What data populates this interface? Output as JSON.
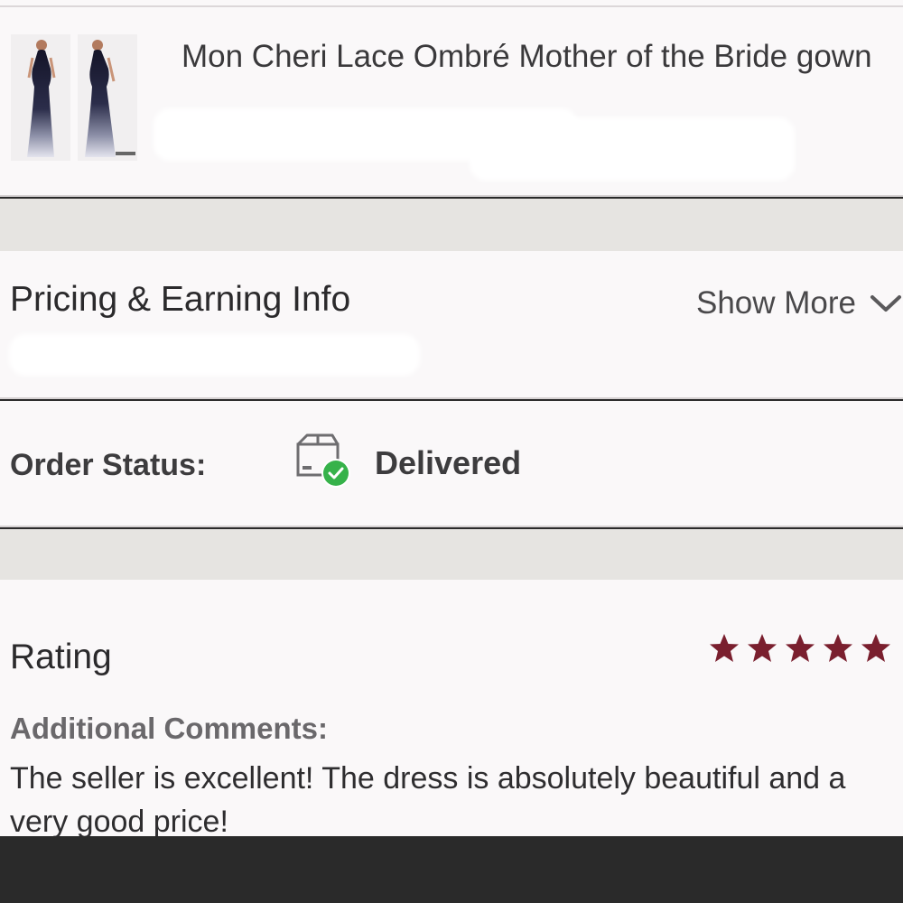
{
  "product": {
    "title": "Mon Cheri Lace Ombré Mother of the Bride gown",
    "thumbnails": [
      "dress-image",
      "dress-image"
    ]
  },
  "pricing": {
    "title": "Pricing & Earning Info",
    "show_more_label": "Show More"
  },
  "order": {
    "status_label": "Order Status:",
    "status_value": "Delivered",
    "status_color": "#36b24a"
  },
  "rating": {
    "title": "Rating",
    "stars": 5,
    "max_stars": 5,
    "star_color": "#7a1f2e",
    "comments_label": "Additional Comments:",
    "comment_text": "The seller is excellent! The dress is absolutely beautiful and a very good price!"
  }
}
